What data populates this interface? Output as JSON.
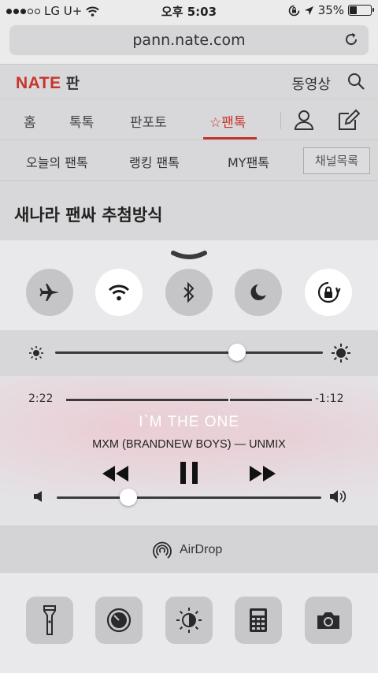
{
  "status_bar": {
    "carrier": "LG U+",
    "time": "오후 5:03",
    "battery_percent": "35%",
    "battery_level": 0.35
  },
  "browser": {
    "url": "pann.nate.com"
  },
  "nate": {
    "logo": "NATE",
    "logo_suffix": "판",
    "video_link": "동영상",
    "tabs": [
      "홈",
      "톡톡",
      "판포토",
      "☆팬톡"
    ],
    "active_tab": "☆팬톡",
    "subtabs": [
      "오늘의 팬톡",
      "랭킹 팬톡",
      "MY팬톡"
    ],
    "channel_button": "채널목록",
    "headline": "새나라 팬싸 추첨방식"
  },
  "control_center": {
    "toggles": [
      {
        "name": "airplane-mode",
        "on": false
      },
      {
        "name": "wifi",
        "on": true
      },
      {
        "name": "bluetooth",
        "on": false
      },
      {
        "name": "do-not-disturb",
        "on": false
      },
      {
        "name": "rotation-lock",
        "on": true
      }
    ],
    "brightness_level": 0.68,
    "music": {
      "elapsed": "2:22",
      "remaining": "-1:12",
      "progress": 0.66,
      "title": "I`M THE ONE",
      "artist": "MXM (BRANDNEW BOYS) — UNMIX"
    },
    "volume_level": 0.27,
    "airdrop_label": "AirDrop",
    "quick_actions": [
      "flashlight",
      "timer",
      "night-shift",
      "calculator",
      "camera"
    ]
  }
}
